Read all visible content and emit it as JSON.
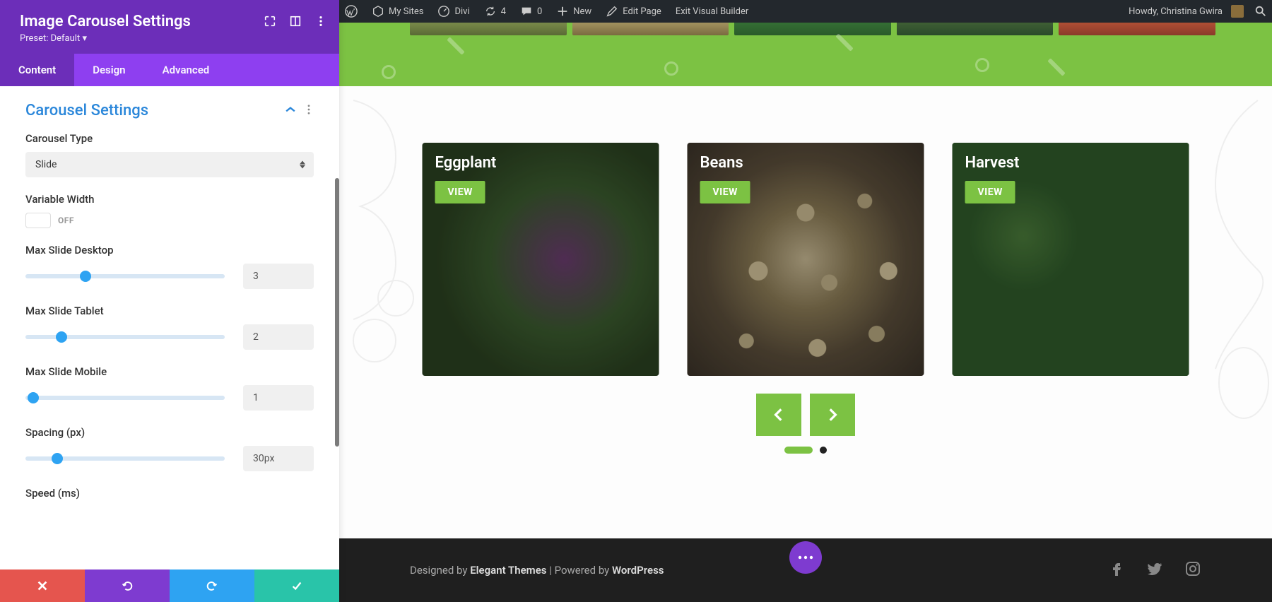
{
  "adminbar": {
    "my_sites": "My Sites",
    "divi": "Divi",
    "updates_count": "4",
    "comments_count": "0",
    "new": "New",
    "edit_page": "Edit Page",
    "exit_vb": "Exit Visual Builder",
    "howdy": "Howdy, Christina Gwira"
  },
  "panel": {
    "title": "Image Carousel Settings",
    "preset_label": "Preset: Default",
    "tabs": {
      "content": "Content",
      "design": "Design",
      "advanced": "Advanced"
    },
    "section_title": "Carousel Settings",
    "fields": {
      "type_label": "Carousel Type",
      "type_value": "Slide",
      "var_width_label": "Variable Width",
      "var_width_state": "OFF",
      "max_desktop_label": "Max Slide Desktop",
      "max_desktop_value": "3",
      "max_tablet_label": "Max Slide Tablet",
      "max_tablet_value": "2",
      "max_mobile_label": "Max Slide Mobile",
      "max_mobile_value": "1",
      "spacing_label": "Spacing (px)",
      "spacing_value": "30px",
      "speed_label": "Speed (ms)"
    }
  },
  "carousel": {
    "cards": [
      {
        "title": "Eggplant",
        "button": "VIEW"
      },
      {
        "title": "Beans",
        "button": "VIEW"
      },
      {
        "title": "Harvest",
        "button": "VIEW"
      }
    ]
  },
  "footer": {
    "designed_by": "Designed by ",
    "theme": "Elegant Themes",
    "sep": " | ",
    "powered_by": "Powered by ",
    "platform": "WordPress"
  },
  "colors": {
    "accent_green": "#7cc243",
    "purple": "#6c2eb9",
    "blue": "#2ea3f2"
  }
}
